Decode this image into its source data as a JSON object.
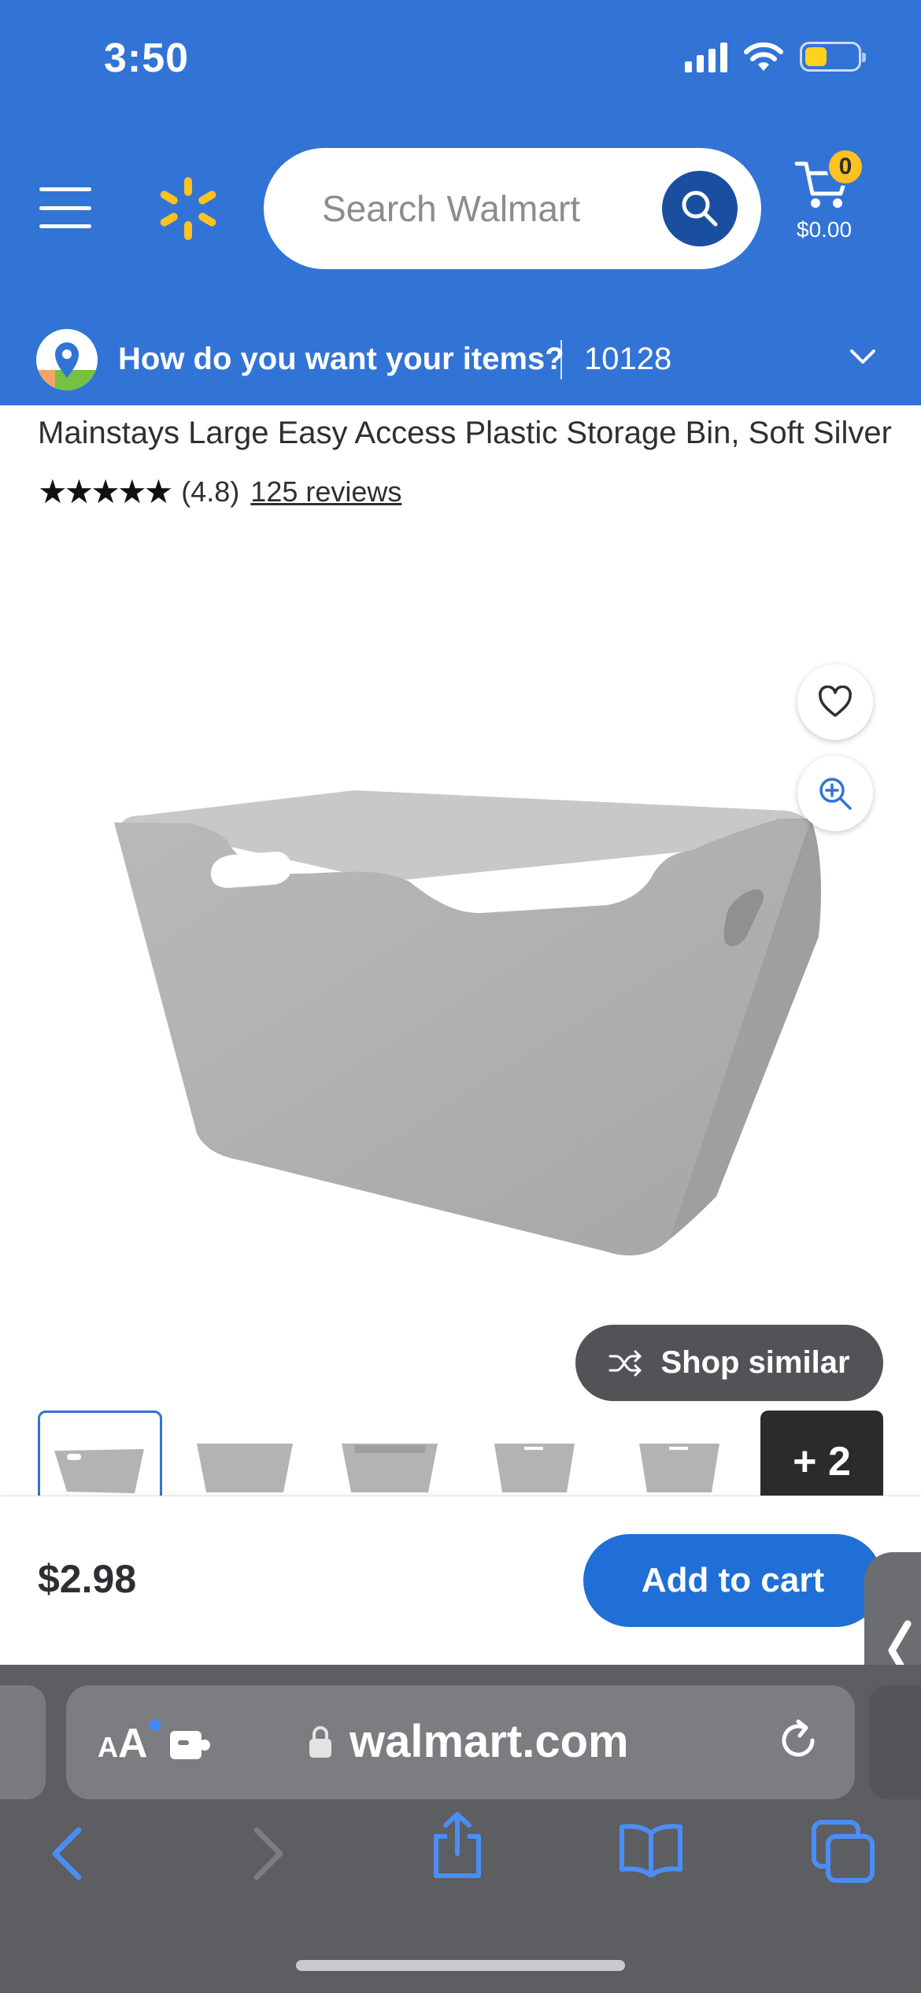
{
  "status_bar": {
    "time": "3:50"
  },
  "header": {
    "search_placeholder": "Search Walmart",
    "cart_count": "0",
    "cart_total": "$0.00",
    "fulfillment_prompt": "How do you want your items?",
    "zip_code": "10128",
    "brand_color": "#3273d6",
    "spark_color": "#ffc220"
  },
  "product": {
    "title": "Mainstays Large Easy Access Plastic Storage Bin, Soft Silver",
    "stars": "★★★★★",
    "rating": "(4.8)",
    "reviews_link": "125 reviews",
    "shop_similar_label": "Shop similar",
    "more_images_label": "+ 2",
    "thumbnail_count": 5
  },
  "purchase": {
    "price": "$2.98",
    "add_to_cart_label": "Add to cart"
  },
  "browser": {
    "aa_small": "A",
    "aa_big": "A",
    "url": "walmart.com"
  },
  "icons": [
    "menu-icon",
    "walmart-spark-icon",
    "search-icon",
    "cart-icon",
    "location-pin-icon",
    "chevron-down-icon",
    "heart-icon",
    "zoom-in-icon",
    "shuffle-icon",
    "chevron-left-icon",
    "lock-icon",
    "reload-icon",
    "share-icon",
    "bookmarks-icon",
    "tabs-icon",
    "puzzle-icon"
  ]
}
